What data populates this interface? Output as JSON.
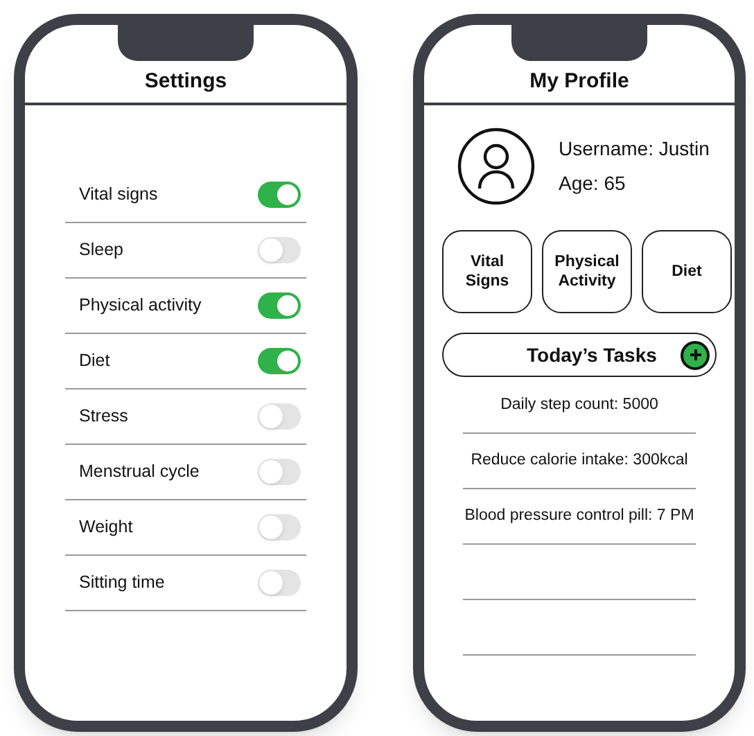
{
  "settings_screen": {
    "title": "Settings",
    "items": [
      {
        "label": "Vital signs",
        "on": true
      },
      {
        "label": "Sleep",
        "on": false
      },
      {
        "label": "Physical activity",
        "on": true
      },
      {
        "label": "Diet",
        "on": true
      },
      {
        "label": "Stress",
        "on": false
      },
      {
        "label": "Menstrual cycle",
        "on": false
      },
      {
        "label": "Weight",
        "on": false
      },
      {
        "label": "Sitting time",
        "on": false
      }
    ]
  },
  "profile_screen": {
    "title": "My Profile",
    "username": "Username: Justin",
    "age": "Age: 65",
    "categories": [
      [
        "Vital",
        "Signs"
      ],
      [
        "Physical",
        "Activity"
      ],
      [
        "Diet"
      ]
    ],
    "tasks_title": "Today’s Tasks",
    "tasks": [
      "Daily step count: 5000",
      "Reduce calorie intake: 300kcal",
      "Blood pressure control pill: 7 PM"
    ]
  }
}
